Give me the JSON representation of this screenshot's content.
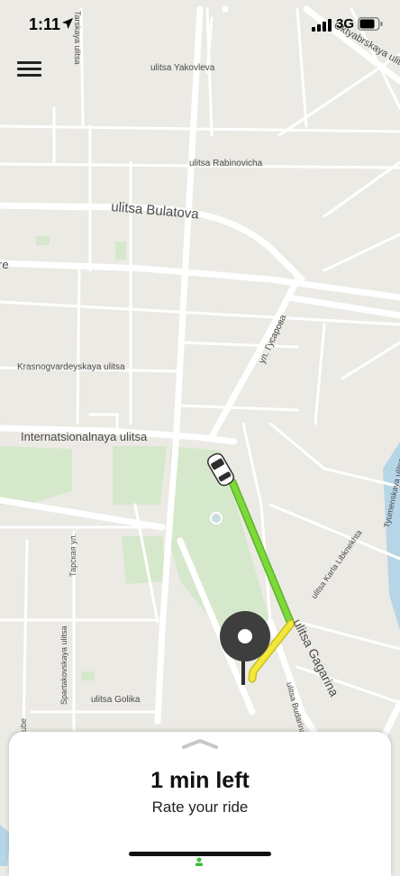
{
  "status_bar": {
    "time": "1:11",
    "network": "3G",
    "icons": [
      "location-arrow-icon",
      "signal-icon",
      "battery-icon"
    ]
  },
  "map": {
    "streets": {
      "yakovleva": "ulitsa Yakovleva",
      "rabinovicha": "ulitsa Rabinovicha",
      "bulatova": "ulitsa Bulatova",
      "krasnogvardeyskaya": "Krasnogvardeyskaya ulitsa",
      "internatsionalnaya": "Internatsionalnaya ulitsa",
      "gusarova": "ул. Гусарова",
      "gagarina": "ulitsa Gagarina",
      "karla_libknekhta": "ulitsa Karla Libknekhta",
      "tyumenskaya": "Tyumenskaya ulitsa",
      "tarskaya_top": "Tarskaya ulitsa",
      "tarskaya_mid": "Тарская ул.",
      "spartakovskaya": "Spartakovskaya ulitsa",
      "golika": "ulitsa Golika",
      "oktyabrskaya": "Oktyabrskaya ulitsa",
      "budarina": "ulitsa Budarina",
      "edge_left": "re",
      "edge_bottom": "ube"
    },
    "colors": {
      "background": "#ECEAE4",
      "road": "#FFFFFF",
      "park": "#D5E8CC",
      "route_primary": "#7DD93A",
      "route_secondary": "#F2E83C",
      "pin": "#3E3E3E"
    }
  },
  "menu": {
    "icon": "hamburger-menu-icon"
  },
  "ride": {
    "eta": "1 min left",
    "rate_label": "Rate your ride"
  }
}
